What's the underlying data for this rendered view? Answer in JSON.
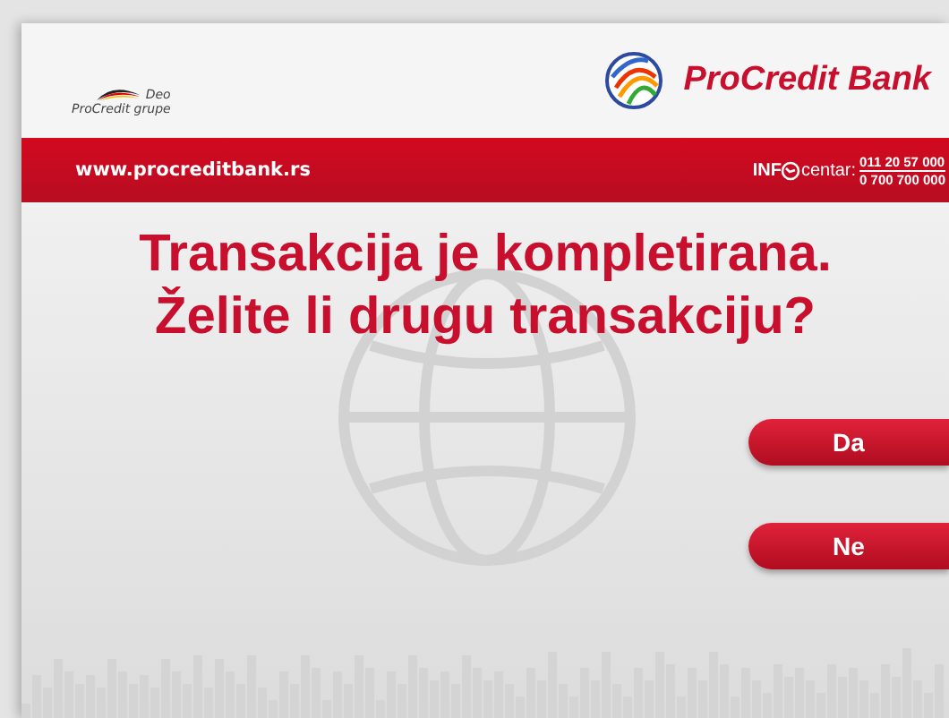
{
  "header": {
    "group_note": [
      "Deo",
      "ProCredit grupe"
    ],
    "bank_name": "ProCredit Bank"
  },
  "red_bar": {
    "website": "www.procreditbank.rs",
    "info_prefix": "INF",
    "info_suffix": "centar:",
    "phones": [
      "011 20 57 000",
      "0 700 700 000"
    ]
  },
  "message": [
    "Transakcija je kompletirana.",
    "Želite li drugu transakciju?"
  ],
  "buttons": [
    "Da",
    "Ne"
  ]
}
